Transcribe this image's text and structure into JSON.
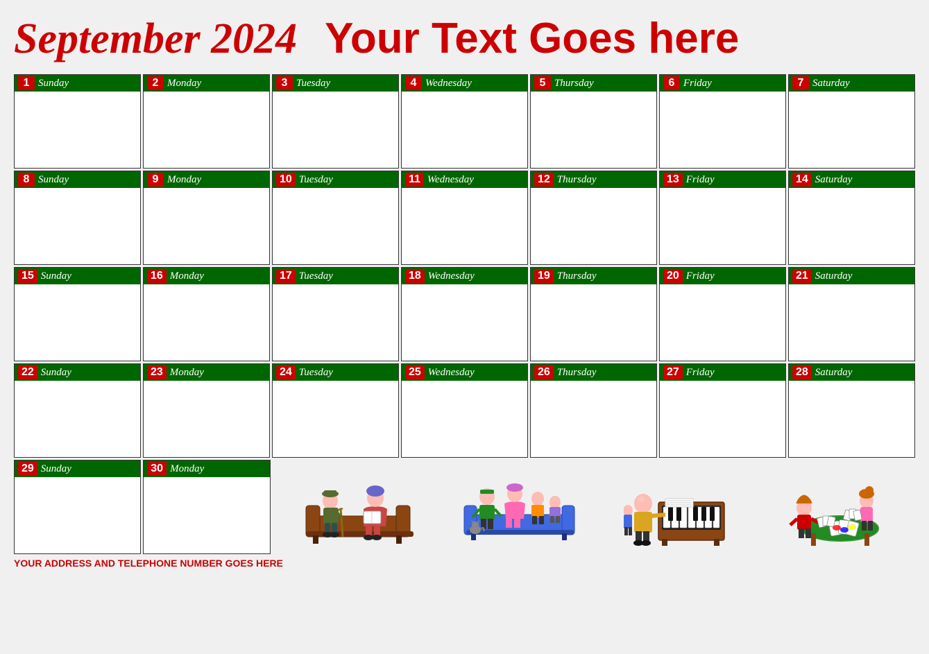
{
  "header": {
    "month_year": "September 2024",
    "custom_text": "Your Text Goes here"
  },
  "calendar": {
    "weeks": [
      [
        {
          "day": 1,
          "dayname": "Sunday"
        },
        {
          "day": 2,
          "dayname": "Monday"
        },
        {
          "day": 3,
          "dayname": "Tuesday"
        },
        {
          "day": 4,
          "dayname": "Wednesday"
        },
        {
          "day": 5,
          "dayname": "Thursday"
        },
        {
          "day": 6,
          "dayname": "Friday"
        },
        {
          "day": 7,
          "dayname": "Saturday"
        }
      ],
      [
        {
          "day": 8,
          "dayname": "Sunday"
        },
        {
          "day": 9,
          "dayname": "Monday"
        },
        {
          "day": 10,
          "dayname": "Tuesday"
        },
        {
          "day": 11,
          "dayname": "Wednesday"
        },
        {
          "day": 12,
          "dayname": "Thursday"
        },
        {
          "day": 13,
          "dayname": "Friday"
        },
        {
          "day": 14,
          "dayname": "Saturday"
        }
      ],
      [
        {
          "day": 15,
          "dayname": "Sunday"
        },
        {
          "day": 16,
          "dayname": "Monday"
        },
        {
          "day": 17,
          "dayname": "Tuesday"
        },
        {
          "day": 18,
          "dayname": "Wednesday"
        },
        {
          "day": 19,
          "dayname": "Thursday"
        },
        {
          "day": 20,
          "dayname": "Friday"
        },
        {
          "day": 21,
          "dayname": "Saturday"
        }
      ],
      [
        {
          "day": 22,
          "dayname": "Sunday"
        },
        {
          "day": 23,
          "dayname": "Monday"
        },
        {
          "day": 24,
          "dayname": "Tuesday"
        },
        {
          "day": 25,
          "dayname": "Wednesday"
        },
        {
          "day": 26,
          "dayname": "Thursday"
        },
        {
          "day": 27,
          "dayname": "Friday"
        },
        {
          "day": 28,
          "dayname": "Saturday"
        }
      ]
    ],
    "last_row": [
      {
        "day": 29,
        "dayname": "Sunday"
      },
      {
        "day": 30,
        "dayname": "Monday"
      }
    ]
  },
  "footer": {
    "address": "YOUR ADDRESS AND TELEPHONE NUMBER GOES HERE"
  }
}
